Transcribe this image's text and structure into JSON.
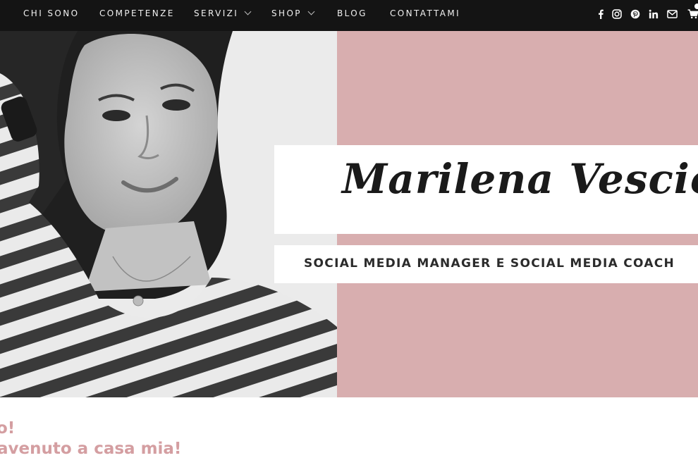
{
  "nav": {
    "items": [
      {
        "label": "CHI SONO",
        "has_dropdown": false
      },
      {
        "label": "COMPETENZE",
        "has_dropdown": false
      },
      {
        "label": "SERVIZI",
        "has_dropdown": true
      },
      {
        "label": "SHOP",
        "has_dropdown": true
      },
      {
        "label": "BLOG",
        "has_dropdown": false
      },
      {
        "label": "CONTATTAMI",
        "has_dropdown": false
      }
    ],
    "social_icons": [
      "facebook-icon",
      "instagram-icon",
      "pinterest-icon",
      "linkedin-icon",
      "envelope-icon",
      "cart-icon"
    ]
  },
  "hero": {
    "name": "Marilena Vescio",
    "tagline": "SOCIAL MEDIA MANAGER E SOCIAL MEDIA COACH",
    "background_color": "#d8aeaf"
  },
  "welcome": {
    "line1": "o!",
    "line2": "avenuto a casa mia!",
    "color": "#d49ea1"
  }
}
